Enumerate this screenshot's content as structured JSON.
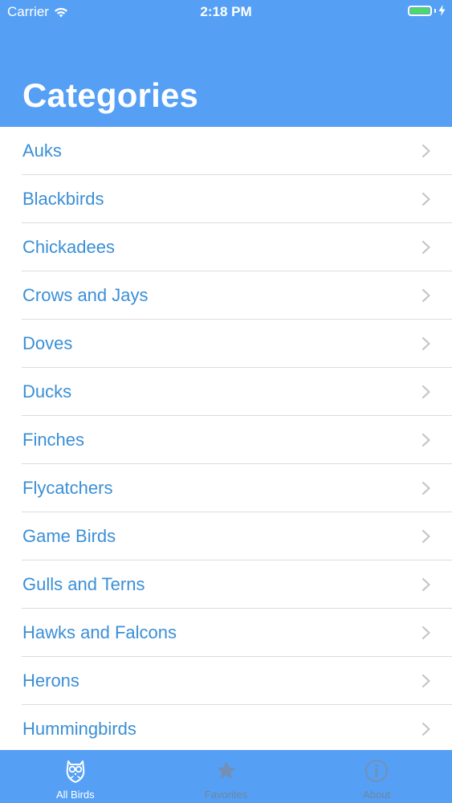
{
  "status_bar": {
    "carrier": "Carrier",
    "time": "2:18 PM",
    "battery_color": "#4cd964"
  },
  "header": {
    "title": "Categories",
    "background": "#55a0f5"
  },
  "categories": [
    {
      "label": "Auks"
    },
    {
      "label": "Blackbirds"
    },
    {
      "label": "Chickadees"
    },
    {
      "label": "Crows and Jays"
    },
    {
      "label": "Doves"
    },
    {
      "label": "Ducks"
    },
    {
      "label": "Finches"
    },
    {
      "label": "Flycatchers"
    },
    {
      "label": "Game Birds"
    },
    {
      "label": "Gulls and Terns"
    },
    {
      "label": "Hawks and Falcons"
    },
    {
      "label": "Herons"
    },
    {
      "label": "Hummingbirds"
    }
  ],
  "tab_bar": {
    "tabs": [
      {
        "label": "All Birds",
        "icon": "owl-icon",
        "active": true
      },
      {
        "label": "Favorites",
        "icon": "star-icon",
        "active": false
      },
      {
        "label": "About",
        "icon": "info-icon",
        "active": false
      }
    ]
  }
}
